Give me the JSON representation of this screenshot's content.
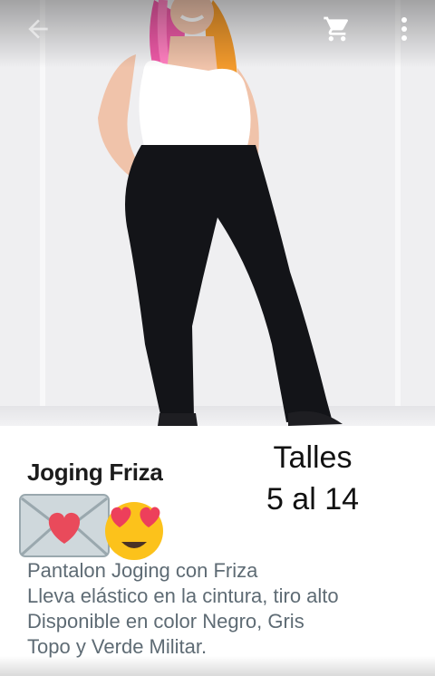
{
  "product": {
    "title": "Joging Friza",
    "sizes_label": "Talles",
    "sizes_range": "5 al 14",
    "description": [
      "Pantalon Joging con Friza",
      "Lleva elástico en la cintura, tiro alto",
      "Disponible en color Negro, Gris",
      "Topo y Verde Militar."
    ],
    "emojis": [
      "love-letter-icon",
      "heart-eyes-icon"
    ]
  },
  "appbar": {
    "back_icon": "arrow-back-icon",
    "cart_icon": "cart-icon",
    "menu_icon": "more-vertical-icon",
    "icon_color": "#ffffff"
  }
}
